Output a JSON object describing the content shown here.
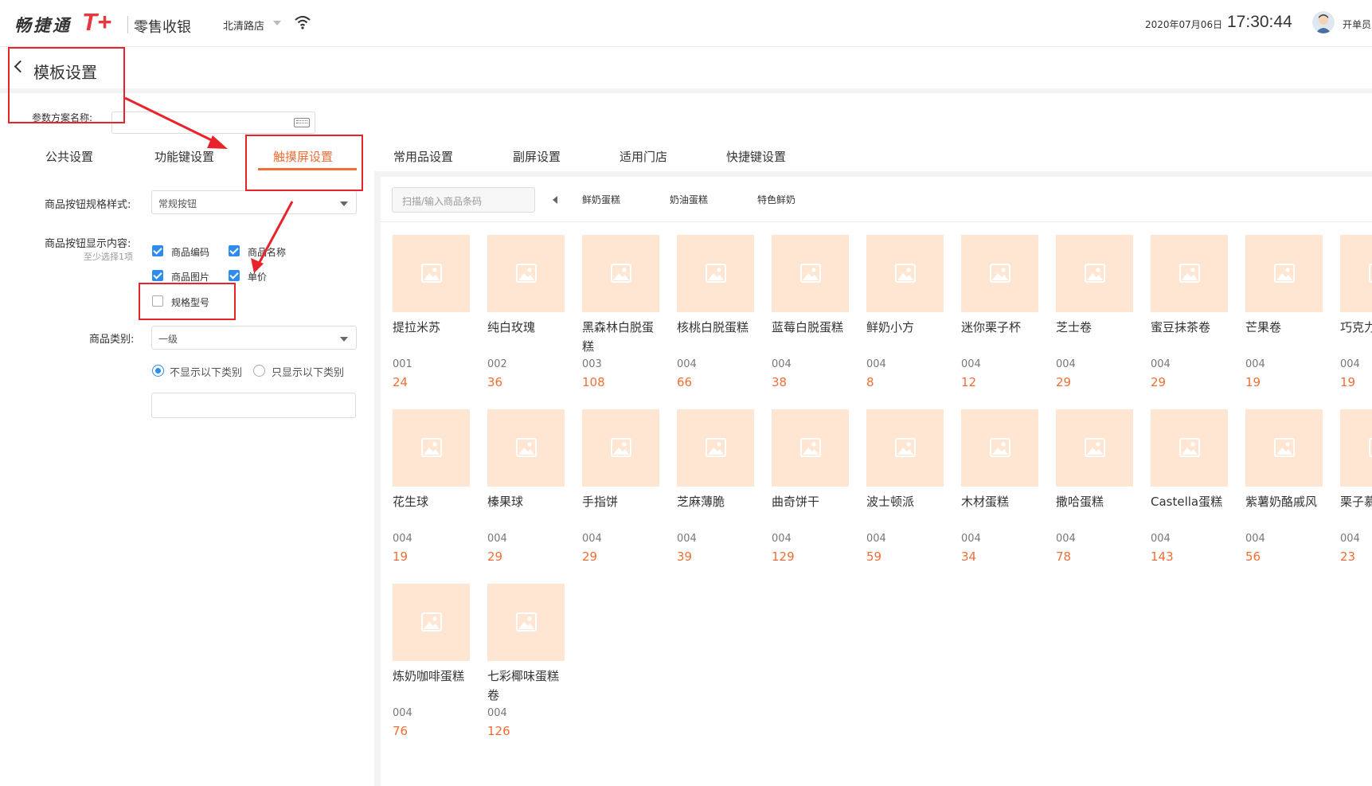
{
  "header": {
    "brand": "畅捷通",
    "brand_mark": "T+",
    "module": "零售收银",
    "store": "北清路店",
    "date": "2020年07月06日",
    "time": "17:30:44",
    "user": "开单员"
  },
  "page": {
    "title": "模板设置",
    "scheme_label": "参数方案名称:"
  },
  "tabs": [
    {
      "label": "公共设置"
    },
    {
      "label": "功能键设置"
    },
    {
      "label": "触摸屏设置"
    },
    {
      "label": "常用品设置"
    },
    {
      "label": "副屏设置"
    },
    {
      "label": "适用门店"
    },
    {
      "label": "快捷键设置"
    }
  ],
  "settings": {
    "style_label": "商品按钮规格样式:",
    "style_value": "常规按钮",
    "display_label": "商品按钮显示内容:",
    "display_hint": "至少选择1项",
    "checkboxes": [
      {
        "label": "商品编码",
        "checked": true
      },
      {
        "label": "商品名称",
        "checked": true
      },
      {
        "label": "商品图片",
        "checked": true
      },
      {
        "label": "单价",
        "checked": true
      },
      {
        "label": "规格型号",
        "checked": false
      }
    ],
    "category_label": "商品类别:",
    "category_value": "一级",
    "radios": [
      {
        "label": "不显示以下类别",
        "checked": true
      },
      {
        "label": "只显示以下类别",
        "checked": false
      }
    ]
  },
  "preview": {
    "scan_placeholder": "扫描/输入商品条码",
    "categories": [
      "鲜奶蛋糕",
      "奶油蛋糕",
      "特色鲜奶"
    ],
    "products": [
      {
        "name": "提拉米苏",
        "code": "001",
        "price": "24"
      },
      {
        "name": "纯白玫瑰",
        "code": "002",
        "price": "36"
      },
      {
        "name": "黑森林白脱蛋糕",
        "code": "003",
        "price": "108"
      },
      {
        "name": "核桃白脱蛋糕",
        "code": "004",
        "price": "66"
      },
      {
        "name": "蓝莓白脱蛋糕",
        "code": "004",
        "price": "38"
      },
      {
        "name": "鲜奶小方",
        "code": "004",
        "price": "8"
      },
      {
        "name": "迷你栗子杯",
        "code": "004",
        "price": "12"
      },
      {
        "name": "芝士卷",
        "code": "004",
        "price": "29"
      },
      {
        "name": "蜜豆抹茶卷",
        "code": "004",
        "price": "29"
      },
      {
        "name": "芒果卷",
        "code": "004",
        "price": "19"
      },
      {
        "name": "巧克力",
        "code": "004",
        "price": "19"
      },
      {
        "name": "花生球",
        "code": "004",
        "price": "19"
      },
      {
        "name": "榛果球",
        "code": "004",
        "price": "29"
      },
      {
        "name": "手指饼",
        "code": "004",
        "price": "29"
      },
      {
        "name": "芝麻薄脆",
        "code": "004",
        "price": "39"
      },
      {
        "name": "曲奇饼干",
        "code": "004",
        "price": "129"
      },
      {
        "name": "波士顿派",
        "code": "004",
        "price": "59"
      },
      {
        "name": "木材蛋糕",
        "code": "004",
        "price": "34"
      },
      {
        "name": "撒哈蛋糕",
        "code": "004",
        "price": "78"
      },
      {
        "name": "Castella蛋糕",
        "code": "004",
        "price": "143"
      },
      {
        "name": "紫薯奶酪戚风",
        "code": "004",
        "price": "56"
      },
      {
        "name": "栗子慕士蛋糕",
        "code": "004",
        "price": "23"
      },
      {
        "name": "炼奶咖啡蛋糕",
        "code": "004",
        "price": "76"
      },
      {
        "name": "七彩椰味蛋糕卷",
        "code": "004",
        "price": "126"
      }
    ]
  },
  "colors": {
    "accent": "#f06e35",
    "brand_red": "#e8383d",
    "checkbox_blue": "#2d8cf0",
    "thumb_bg": "#ffe6d2",
    "annotation_red": "#e8242b"
  }
}
